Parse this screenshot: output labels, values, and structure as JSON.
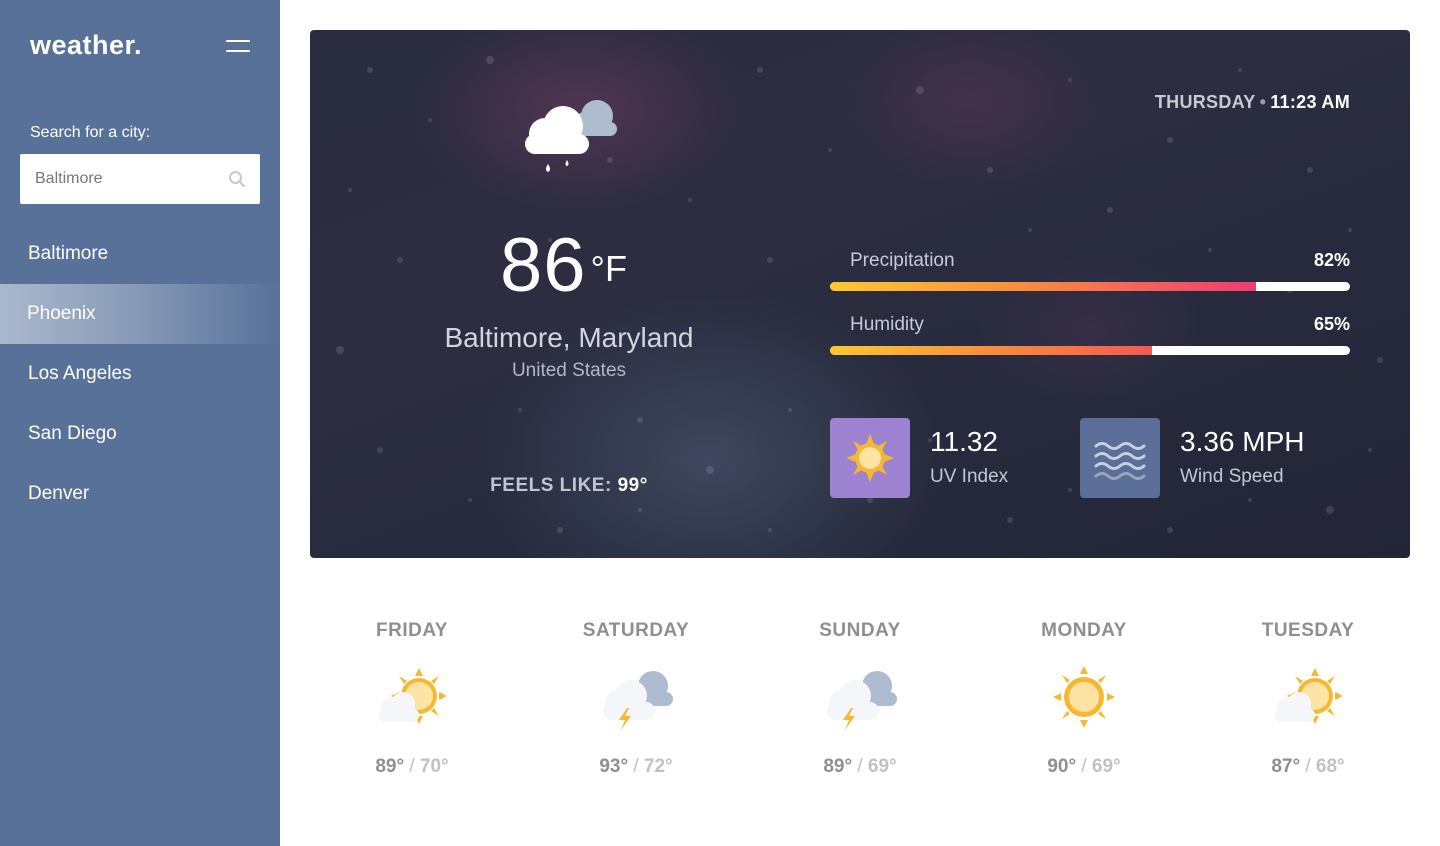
{
  "app": {
    "logo": "weather."
  },
  "sidebar": {
    "search_label": "Search for a city:",
    "search_value": "Baltimore",
    "cities": [
      {
        "label": "Baltimore"
      },
      {
        "label": "Phoenix"
      },
      {
        "label": "Los Angeles"
      },
      {
        "label": "San Diego"
      },
      {
        "label": "Denver"
      }
    ],
    "active_city_index": 1
  },
  "current": {
    "day": "THURSDAY",
    "separator": "•",
    "time": "11:23 AM",
    "icon": "rain-cloud-icon",
    "temperature": "86",
    "unit": "°F",
    "location": "Baltimore, Maryland",
    "country": "United States",
    "feels_like_label": "FEELS LIKE:",
    "feels_like_value": "99°",
    "precipitation": {
      "label": "Precipitation",
      "value": "82%",
      "fraction": 0.82
    },
    "humidity": {
      "label": "Humidity",
      "value": "65%",
      "fraction": 0.62
    },
    "uv": {
      "value": "11.32",
      "label": "UV Index",
      "icon": "sun-icon"
    },
    "wind": {
      "value": "3.36 MPH",
      "label": "Wind Speed",
      "icon": "wind-icon"
    }
  },
  "forecast": [
    {
      "day": "FRIDAY",
      "high": "89°",
      "low": "70°",
      "icon": "partly-sunny-icon"
    },
    {
      "day": "SATURDAY",
      "high": "93°",
      "low": "72°",
      "icon": "thunderstorm-icon"
    },
    {
      "day": "SUNDAY",
      "high": "89°",
      "low": "69°",
      "icon": "thunderstorm-icon"
    },
    {
      "day": "MONDAY",
      "high": "90°",
      "low": "69°",
      "icon": "sunny-icon"
    },
    {
      "day": "TUESDAY",
      "high": "87°",
      "low": "68°",
      "icon": "partly-sunny-icon"
    }
  ],
  "forecast_separator": "/",
  "colors": {
    "sidebar": "#577199",
    "uv_tile": "#9e82d2",
    "wind_tile": "#5a6e98",
    "bar_start": "#fdc830",
    "bar_end": "#ef3b73",
    "sun": "#f6b732"
  }
}
